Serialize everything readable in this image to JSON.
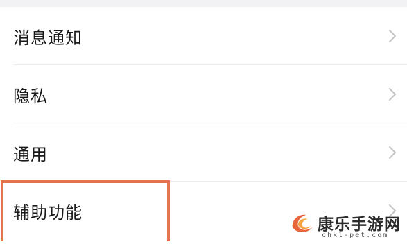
{
  "settings_list": {
    "items": [
      {
        "label": "消息通知"
      },
      {
        "label": "隐私"
      },
      {
        "label": "通用"
      },
      {
        "label": "辅助功能"
      }
    ]
  },
  "highlight": {
    "color": "#e5734f"
  },
  "watermark": {
    "title": "康乐手游网",
    "subtitle": "chkl-pet.com"
  },
  "icons": {
    "chevron": "chevron-right-icon",
    "logo": "flame-logo-icon"
  }
}
